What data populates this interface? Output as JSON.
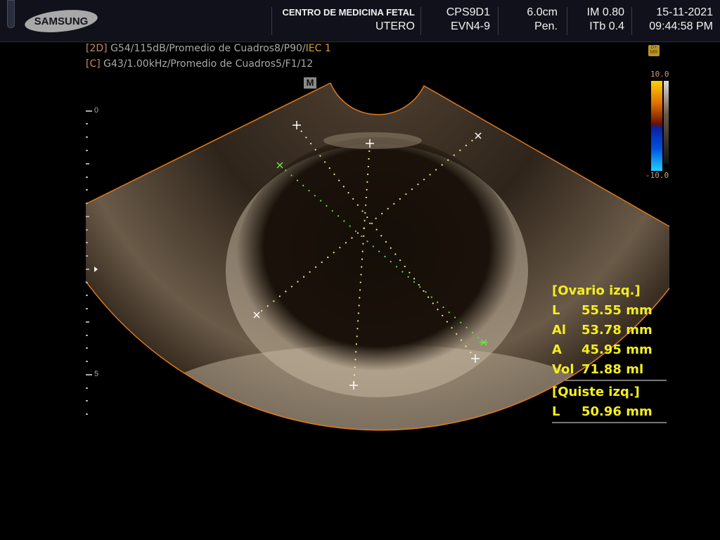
{
  "header": {
    "brand": "SAMSUNG",
    "institution": "CENTRO DE MEDICINA FETAL",
    "preset": "UTERO",
    "probe": "CPS9D1",
    "probe_sub": "EVN4-9",
    "depth": "6.0cm",
    "mode": "Pen.",
    "mi": "IM 0.80",
    "tib": "ITb 0.4",
    "date": "15-11-2021",
    "time": "09:44:58 PM"
  },
  "params": {
    "line1_tag": "[2D]",
    "line1_text": "G54/115dB/Promedio de Cuadros8/P90/",
    "line1_iec": "IEC 1",
    "line2_tag": "[C]",
    "line2_text": "G43/1.00kHz/Promedio de Cuadros5/F1/12"
  },
  "colorbar": {
    "max": "10.0",
    "min": "-10.0",
    "badge": "D+ MR"
  },
  "scale": {
    "top": "0",
    "mid": "5"
  },
  "marker": "M",
  "measurements": {
    "ovary_title": "[Ovario izq.]",
    "ovary": [
      {
        "key": "L",
        "value": "55.55 mm"
      },
      {
        "key": "Al",
        "value": "53.78 mm"
      },
      {
        "key": "A",
        "value": "45.95 mm"
      },
      {
        "key": "Vol",
        "value": "71.88 ml"
      }
    ],
    "cyst_title": "[Quiste izq.]",
    "cyst": [
      {
        "key": "L",
        "value": "50.96 mm"
      }
    ]
  },
  "colors": {
    "accent": "#f4ee20",
    "sector_border": "#e07820",
    "caliper_green": "#6fe04a"
  }
}
